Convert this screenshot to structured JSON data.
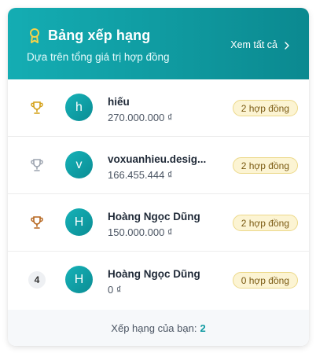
{
  "header": {
    "title": "Bảng xếp hạng",
    "subtitle": "Dựa trên tổng giá trị hợp đồng",
    "see_all": "Xem tất cả",
    "medal_icon": "award-icon",
    "chevron_icon": "chevron-right-icon"
  },
  "rows": [
    {
      "rank_icon": "trophy-gold-icon",
      "rank_color": "#d4a017",
      "avatar": "h",
      "name": "hiếu",
      "amount": "270.000.000 ₫",
      "badge": "2 hợp đồng"
    },
    {
      "rank_icon": "trophy-silver-icon",
      "rank_color": "#9ca3af",
      "avatar": "v",
      "name": "voxuanhieu.desig...",
      "amount": "166.455.444 ₫",
      "badge": "2 hợp đồng"
    },
    {
      "rank_icon": "trophy-bronze-icon",
      "rank_color": "#b5651d",
      "avatar": "H",
      "name": "Hoàng Ngọc Dũng",
      "amount": "150.000.000 ₫",
      "badge": "2 hợp đồng"
    },
    {
      "rank_number": "4",
      "avatar": "H",
      "name": "Hoàng Ngọc Dũng",
      "amount": "0 ₫",
      "badge": "0 hợp đồng"
    }
  ],
  "footer": {
    "label": "Xếp hạng của bạn:",
    "value": "2"
  },
  "colors": {
    "accent": "#0f9aa1",
    "badge_bg": "#fcf4d3",
    "badge_border": "#ecd98a"
  }
}
